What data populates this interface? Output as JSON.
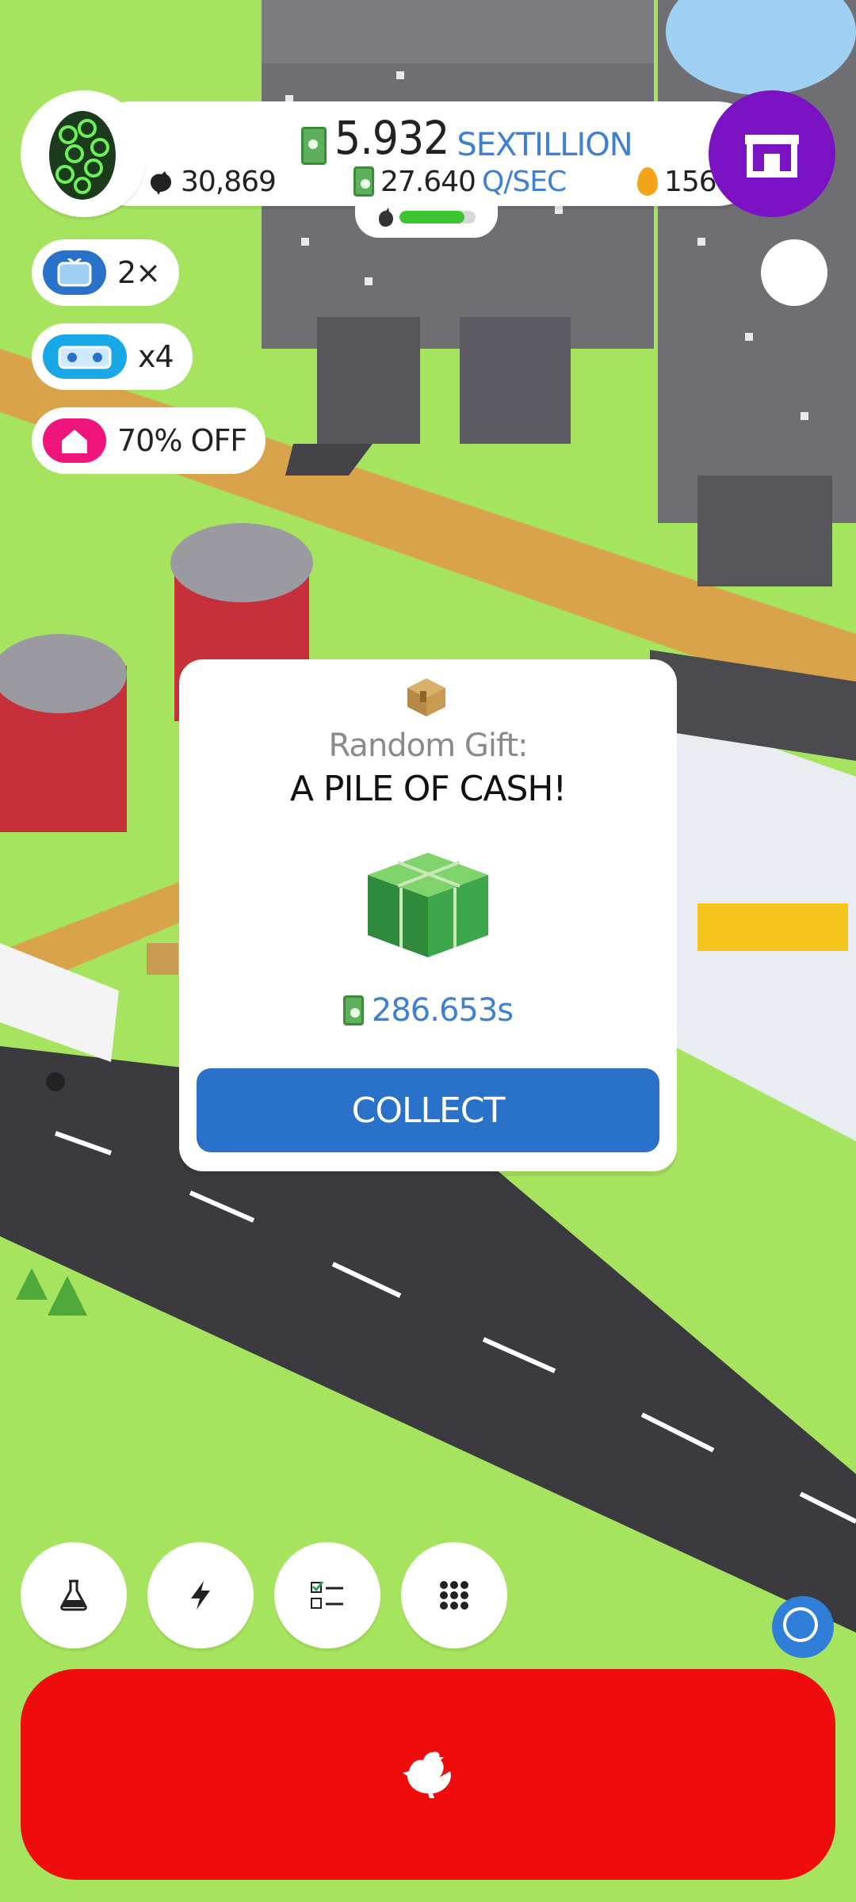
{
  "hud": {
    "money_value": "5.932",
    "money_unit": "SEXTILLION",
    "chickens": "30,869",
    "rate_value": "27.640",
    "rate_unit": "Q/SEC",
    "golden_eggs": "156",
    "hatch_progress": 0.85
  },
  "boosts": [
    {
      "label": "2×",
      "icon": "tv-video-ad-icon"
    },
    {
      "label": "x4",
      "icon": "drone-bonus-icon"
    },
    {
      "label": "70% OFF",
      "icon": "home-sale-icon"
    }
  ],
  "gift_dialog": {
    "title": "Random Gift:",
    "name": "A PILE OF CASH!",
    "reward": "286.653s",
    "collect_label": "COLLECT"
  },
  "bottom_buttons": [
    {
      "name": "research-button",
      "icon": "flask-icon"
    },
    {
      "name": "boost-button",
      "icon": "lightning-icon"
    },
    {
      "name": "missions-button",
      "icon": "checklist-icon"
    },
    {
      "name": "menu-button",
      "icon": "grid-menu-icon"
    }
  ],
  "colors": {
    "grass": "#a6e45f",
    "road": "#3b3b3f",
    "accent_blue": "#2a72c9",
    "shop_purple": "#7a12c4",
    "hatch_red": "#ee0c0c"
  }
}
